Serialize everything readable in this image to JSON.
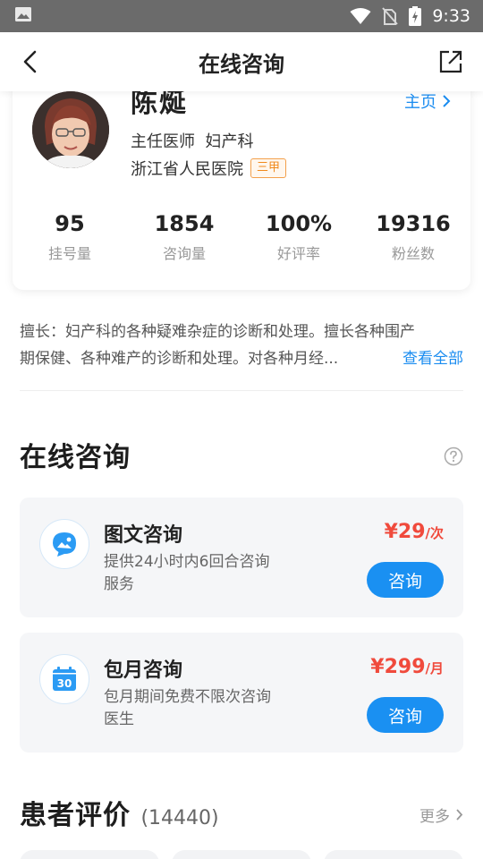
{
  "status_bar": {
    "time": "9:33"
  },
  "nav": {
    "title": "在线咨询"
  },
  "doctor": {
    "name": "陈烻",
    "homepage_label": "主页",
    "title": "主任医师  妇产科",
    "hospital": "浙江省人民医院",
    "hospital_badge": "三甲",
    "stats": [
      {
        "value": "95",
        "label": "挂号量"
      },
      {
        "value": "1854",
        "label": "咨询量"
      },
      {
        "value": "100%",
        "label": "好评率"
      },
      {
        "value": "19316",
        "label": "粉丝数"
      }
    ]
  },
  "specialty": {
    "line1": "擅长：妇产科的各种疑难杂症的诊断和处理。擅长各种围产",
    "line2": "期保健、各种难产的诊断和处理。对各种月经...",
    "view_all": "查看全部"
  },
  "online_consult": {
    "title": "在线咨询",
    "items": [
      {
        "name": "图文咨询",
        "desc": "提供24小时内6回合咨询服务",
        "price": "¥29",
        "unit": "/次",
        "button": "咨询",
        "icon": "chat-image-icon"
      },
      {
        "name": "包月咨询",
        "desc": "包月期间免费不限次咨询医生",
        "price": "¥299",
        "unit": "/月",
        "button": "咨询",
        "icon": "calendar-icon",
        "icon_text": "30"
      }
    ]
  },
  "reviews": {
    "title": "患者评价",
    "count": "(14440)",
    "more": "更多"
  },
  "colors": {
    "accent": "#1a90f2",
    "price": "#f04a3c",
    "badge": "#f08a1c"
  }
}
